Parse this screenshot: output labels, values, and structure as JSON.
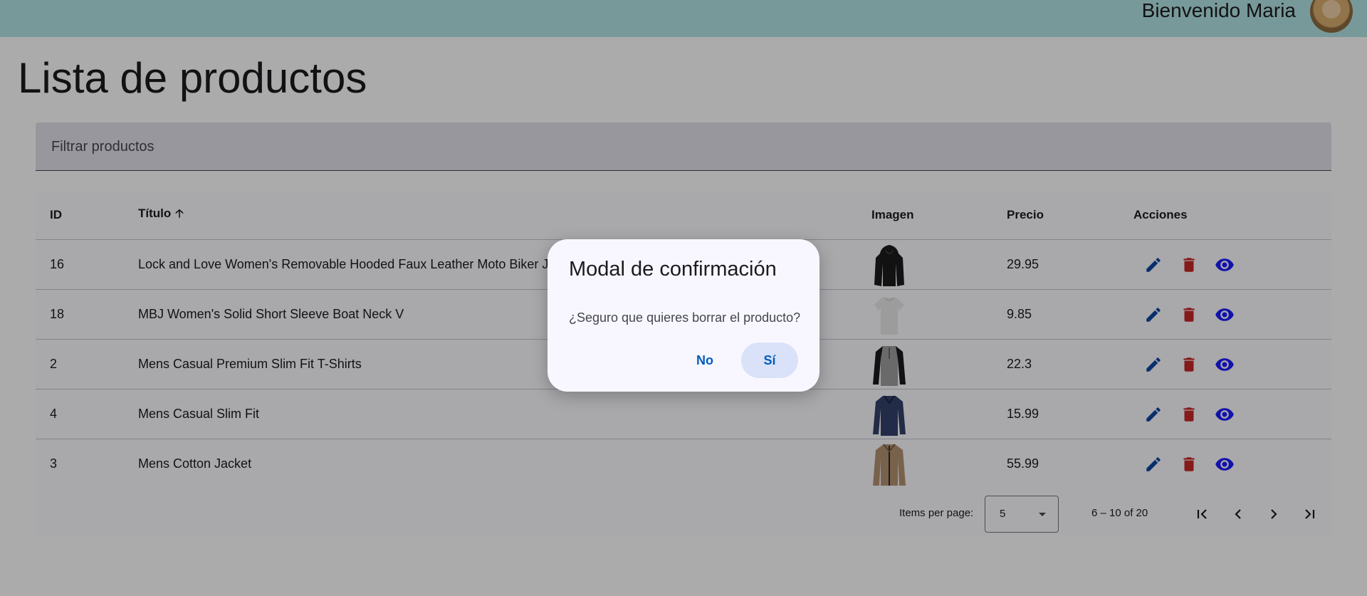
{
  "header": {
    "welcome": "Bienvenido Maria"
  },
  "page": {
    "title": "Lista de productos"
  },
  "filter": {
    "placeholder": "Filtrar productos"
  },
  "table": {
    "columns": {
      "id": "ID",
      "title": "Título",
      "image": "Imagen",
      "price": "Precio",
      "actions": "Acciones"
    },
    "rows": [
      {
        "id": "16",
        "title": "Lock and Love Women's Removable Hooded Faux Leather Moto Biker Ja",
        "price": "29.95",
        "image": "black-hooded-jacket"
      },
      {
        "id": "18",
        "title": "MBJ Women's Solid Short Sleeve Boat Neck V",
        "price": "9.85",
        "image": "white-short-sleeve-top"
      },
      {
        "id": "2",
        "title": "Mens Casual Premium Slim Fit T-Shirts",
        "price": "22.3",
        "image": "grey-black-henley-shirt"
      },
      {
        "id": "4",
        "title": "Mens Casual Slim Fit",
        "price": "15.99",
        "image": "navy-long-sleeve-shirt"
      },
      {
        "id": "3",
        "title": "Mens Cotton Jacket",
        "price": "55.99",
        "image": "khaki-cotton-jacket"
      }
    ]
  },
  "paginator": {
    "items_per_page_label": "Items per page:",
    "page_size": "5",
    "range": "6 – 10 of 20"
  },
  "dialog": {
    "title": "Modal de confirmación",
    "message": "¿Seguro que quieres borrar el producto?",
    "no": "No",
    "yes": "Sí"
  },
  "colors": {
    "edit": "#0d47a1",
    "delete": "#c62828",
    "view": "#1a1aff"
  }
}
